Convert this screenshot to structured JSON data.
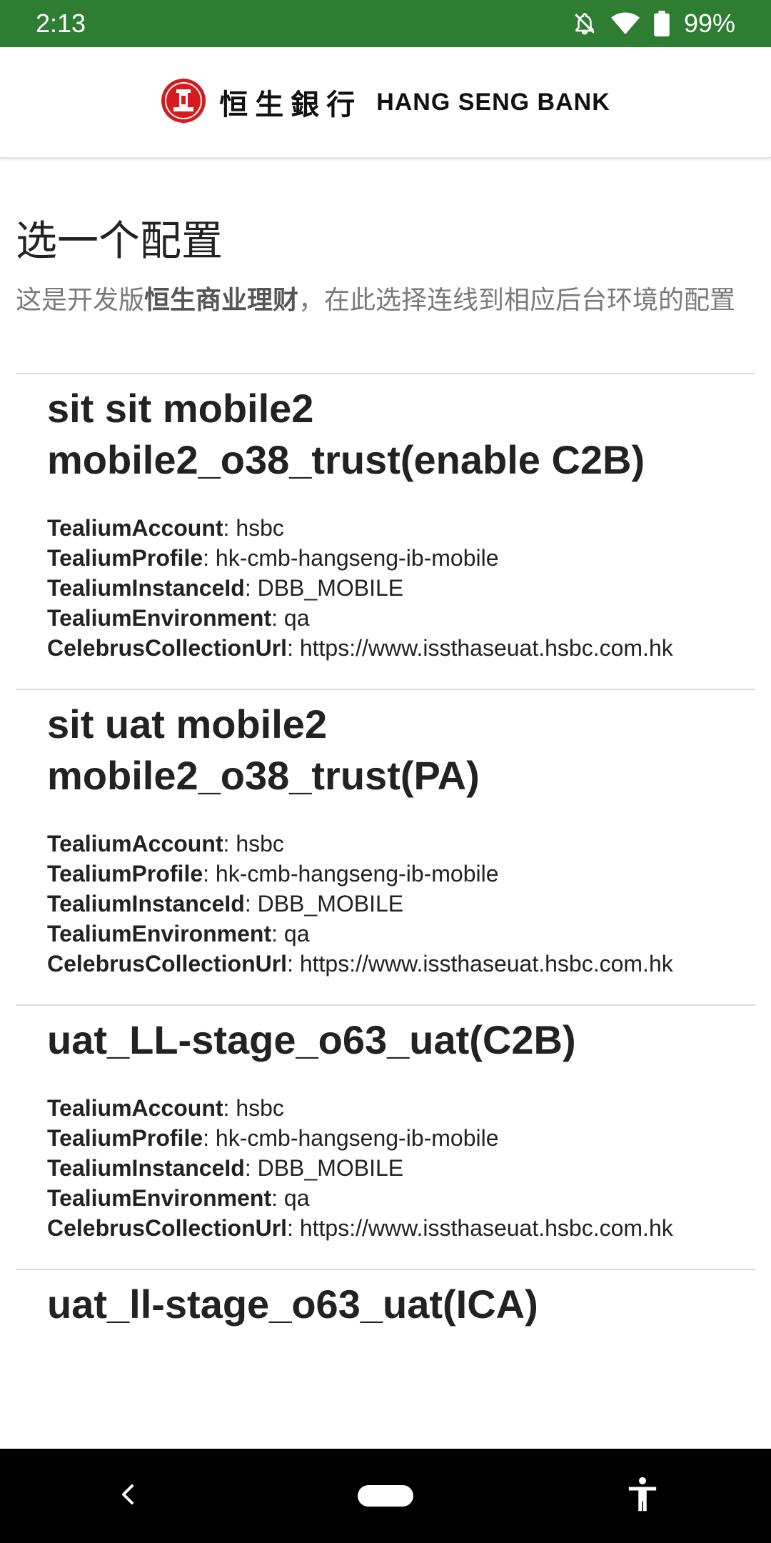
{
  "status_bar": {
    "time": "2:13",
    "battery": "99%",
    "icons": [
      "bell-off-icon",
      "wifi-icon",
      "battery-icon"
    ]
  },
  "header": {
    "brand_cn": "恒生銀行",
    "brand_en": "HANG SENG BANK",
    "logo": "hang-seng-logo"
  },
  "page": {
    "title": "选一个配置",
    "desc_prefix": "这是开发版",
    "desc_bold": "恒生商业理财",
    "desc_suffix": "，在此选择连线到相应后台环境的配置"
  },
  "labels": {
    "account": "TealiumAccount",
    "profile": "TealiumProfile",
    "instance": "TealiumInstanceId",
    "environment": "TealiumEnvironment",
    "celebrus": "CelebrusCollectionUrl"
  },
  "configs": [
    {
      "name": "sit sit mobile2 mobile2_o38_trust(enable C2B)",
      "account": ": hsbc",
      "profile": ": hk-cmb-hangseng-ib-mobile",
      "instance": ": DBB_MOBILE",
      "environment": ": qa",
      "celebrus": ": https://www.issthaseuat.hsbc.com.hk"
    },
    {
      "name": "sit uat mobile2 mobile2_o38_trust(PA)",
      "account": ": hsbc",
      "profile": ": hk-cmb-hangseng-ib-mobile",
      "instance": ": DBB_MOBILE",
      "environment": ": qa",
      "celebrus": ": https://www.issthaseuat.hsbc.com.hk"
    },
    {
      "name": "uat_LL-stage_o63_uat(C2B)",
      "account": ": hsbc",
      "profile": ": hk-cmb-hangseng-ib-mobile",
      "instance": ": DBB_MOBILE",
      "environment": ": qa",
      "celebrus": ": https://www.issthaseuat.hsbc.com.hk"
    },
    {
      "name": "uat_ll-stage_o63_uat(ICA)"
    }
  ],
  "colors": {
    "status_bar": "#2e7d32",
    "logo_red": "#d71920",
    "divider": "#dcdcdc"
  }
}
